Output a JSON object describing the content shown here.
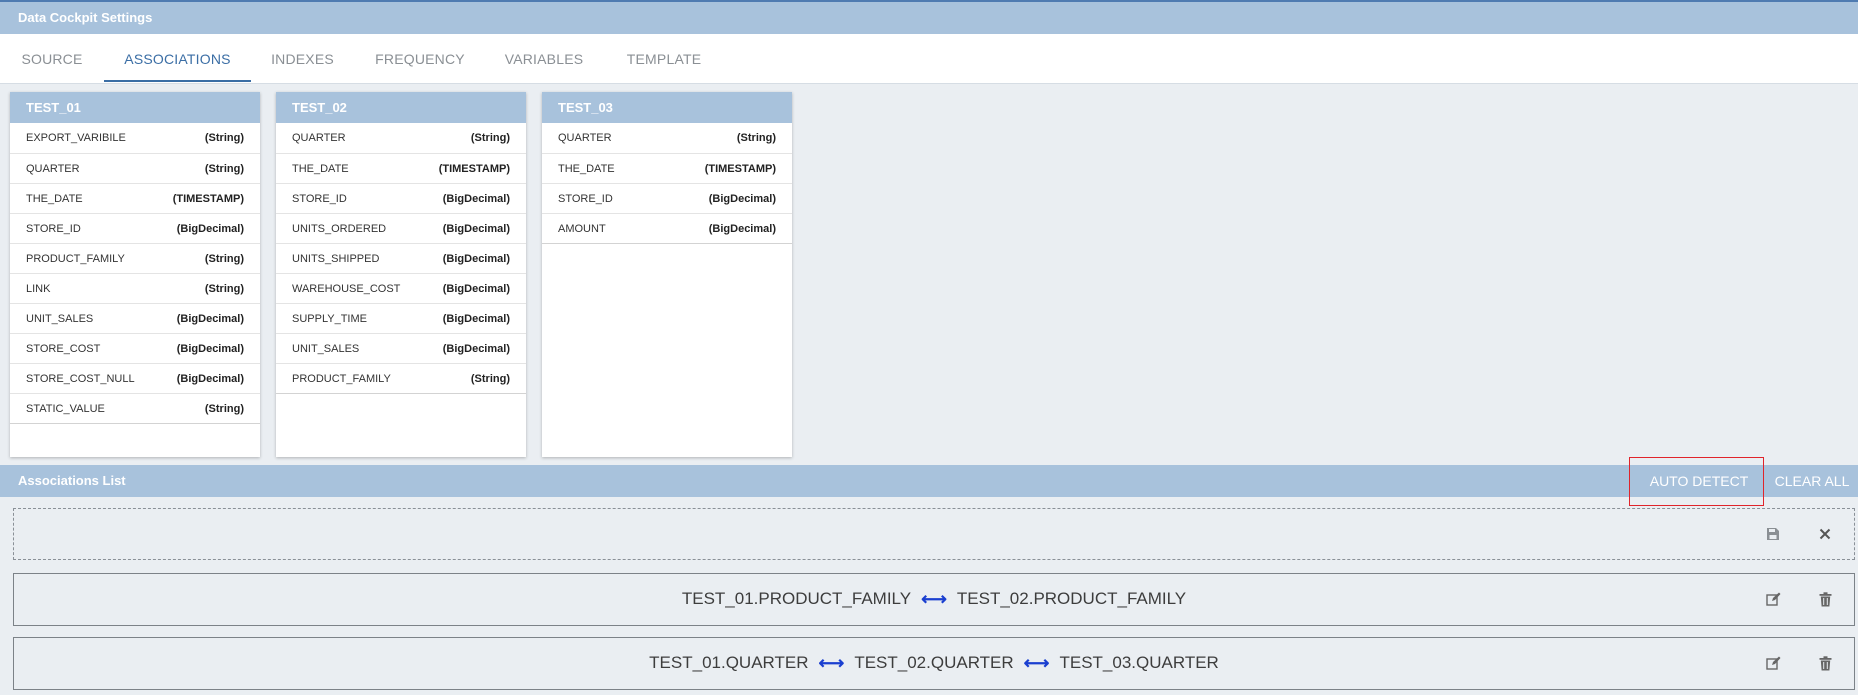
{
  "header": {
    "title": "Data Cockpit Settings"
  },
  "tabs": [
    {
      "label": "SOURCE"
    },
    {
      "label": "ASSOCIATIONS"
    },
    {
      "label": "INDEXES"
    },
    {
      "label": "FREQUENCY"
    },
    {
      "label": "VARIABLES"
    },
    {
      "label": "TEMPLATE"
    }
  ],
  "active_tab": "ASSOCIATIONS",
  "tables": [
    {
      "name": "TEST_01",
      "fields": [
        {
          "name": "EXPORT_VARIBILE",
          "type": "(String)"
        },
        {
          "name": "QUARTER",
          "type": "(String)"
        },
        {
          "name": "THE_DATE",
          "type": "(TIMESTAMP)"
        },
        {
          "name": "STORE_ID",
          "type": "(BigDecimal)"
        },
        {
          "name": "PRODUCT_FAMILY",
          "type": "(String)"
        },
        {
          "name": "LINK",
          "type": "(String)"
        },
        {
          "name": "UNIT_SALES",
          "type": "(BigDecimal)"
        },
        {
          "name": "STORE_COST",
          "type": "(BigDecimal)"
        },
        {
          "name": "STORE_COST_NULL",
          "type": "(BigDecimal)"
        },
        {
          "name": "STATIC_VALUE",
          "type": "(String)"
        }
      ]
    },
    {
      "name": "TEST_02",
      "fields": [
        {
          "name": "QUARTER",
          "type": "(String)"
        },
        {
          "name": "THE_DATE",
          "type": "(TIMESTAMP)"
        },
        {
          "name": "STORE_ID",
          "type": "(BigDecimal)"
        },
        {
          "name": "UNITS_ORDERED",
          "type": "(BigDecimal)"
        },
        {
          "name": "UNITS_SHIPPED",
          "type": "(BigDecimal)"
        },
        {
          "name": "WAREHOUSE_COST",
          "type": "(BigDecimal)"
        },
        {
          "name": "SUPPLY_TIME",
          "type": "(BigDecimal)"
        },
        {
          "name": "UNIT_SALES",
          "type": "(BigDecimal)"
        },
        {
          "name": "PRODUCT_FAMILY",
          "type": "(String)"
        }
      ]
    },
    {
      "name": "TEST_03",
      "fields": [
        {
          "name": "QUARTER",
          "type": "(String)"
        },
        {
          "name": "THE_DATE",
          "type": "(TIMESTAMP)"
        },
        {
          "name": "STORE_ID",
          "type": "(BigDecimal)"
        },
        {
          "name": "AMOUNT",
          "type": "(BigDecimal)"
        }
      ]
    }
  ],
  "associations": {
    "title": "Associations List",
    "auto_detect_label": "AUTO DETECT",
    "clear_all_label": "CLEAR ALL",
    "items": [
      {
        "fields": [
          "TEST_01.PRODUCT_FAMILY",
          "TEST_02.PRODUCT_FAMILY"
        ]
      },
      {
        "fields": [
          "TEST_01.QUARTER",
          "TEST_02.QUARTER",
          "TEST_03.QUARTER"
        ]
      }
    ]
  },
  "icons": {
    "save": "save-icon",
    "close": "close-icon",
    "edit": "edit-icon",
    "delete": "trash-icon",
    "link_arrow": "double-arrow-icon"
  },
  "colors": {
    "header_bg": "#a8c2dc",
    "accent": "#3b6ea5",
    "arrow": "#1a3fd0",
    "highlight_outline": "#e0242b"
  }
}
